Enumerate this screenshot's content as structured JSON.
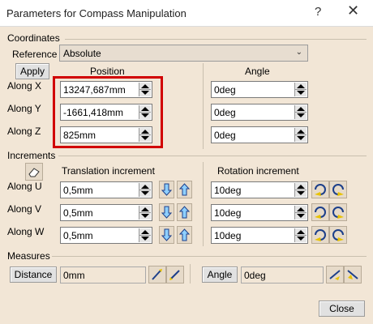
{
  "window": {
    "title": "Parameters for Compass Manipulation",
    "help": "?",
    "close": "✕"
  },
  "coordinates": {
    "label": "Coordinates",
    "reference_label": "Reference",
    "reference_value": "Absolute",
    "apply": "Apply",
    "position_header": "Position",
    "angle_header": "Angle",
    "rows": [
      {
        "label": "Along X",
        "position": "13247,687mm",
        "angle": "0deg"
      },
      {
        "label": "Along Y",
        "position": "-1661,418mm",
        "angle": "0deg"
      },
      {
        "label": "Along Z",
        "position": "825mm",
        "angle": "0deg"
      }
    ]
  },
  "increments": {
    "label": "Increments",
    "translation_header": "Translation increment",
    "rotation_header": "Rotation increment",
    "rows": [
      {
        "label": "Along U",
        "translation": "0,5mm",
        "rotation": "10deg"
      },
      {
        "label": "Along V",
        "translation": "0,5mm",
        "rotation": "10deg"
      },
      {
        "label": "Along W",
        "translation": "0,5mm",
        "rotation": "10deg"
      }
    ]
  },
  "measures": {
    "label": "Measures",
    "distance_button": "Distance",
    "distance_value": "0mm",
    "angle_button": "Angle",
    "angle_value": "0deg"
  },
  "footer": {
    "close": "Close"
  },
  "colors": {
    "highlight": "#d10000",
    "dialog_bg": "#f2e6d6"
  }
}
